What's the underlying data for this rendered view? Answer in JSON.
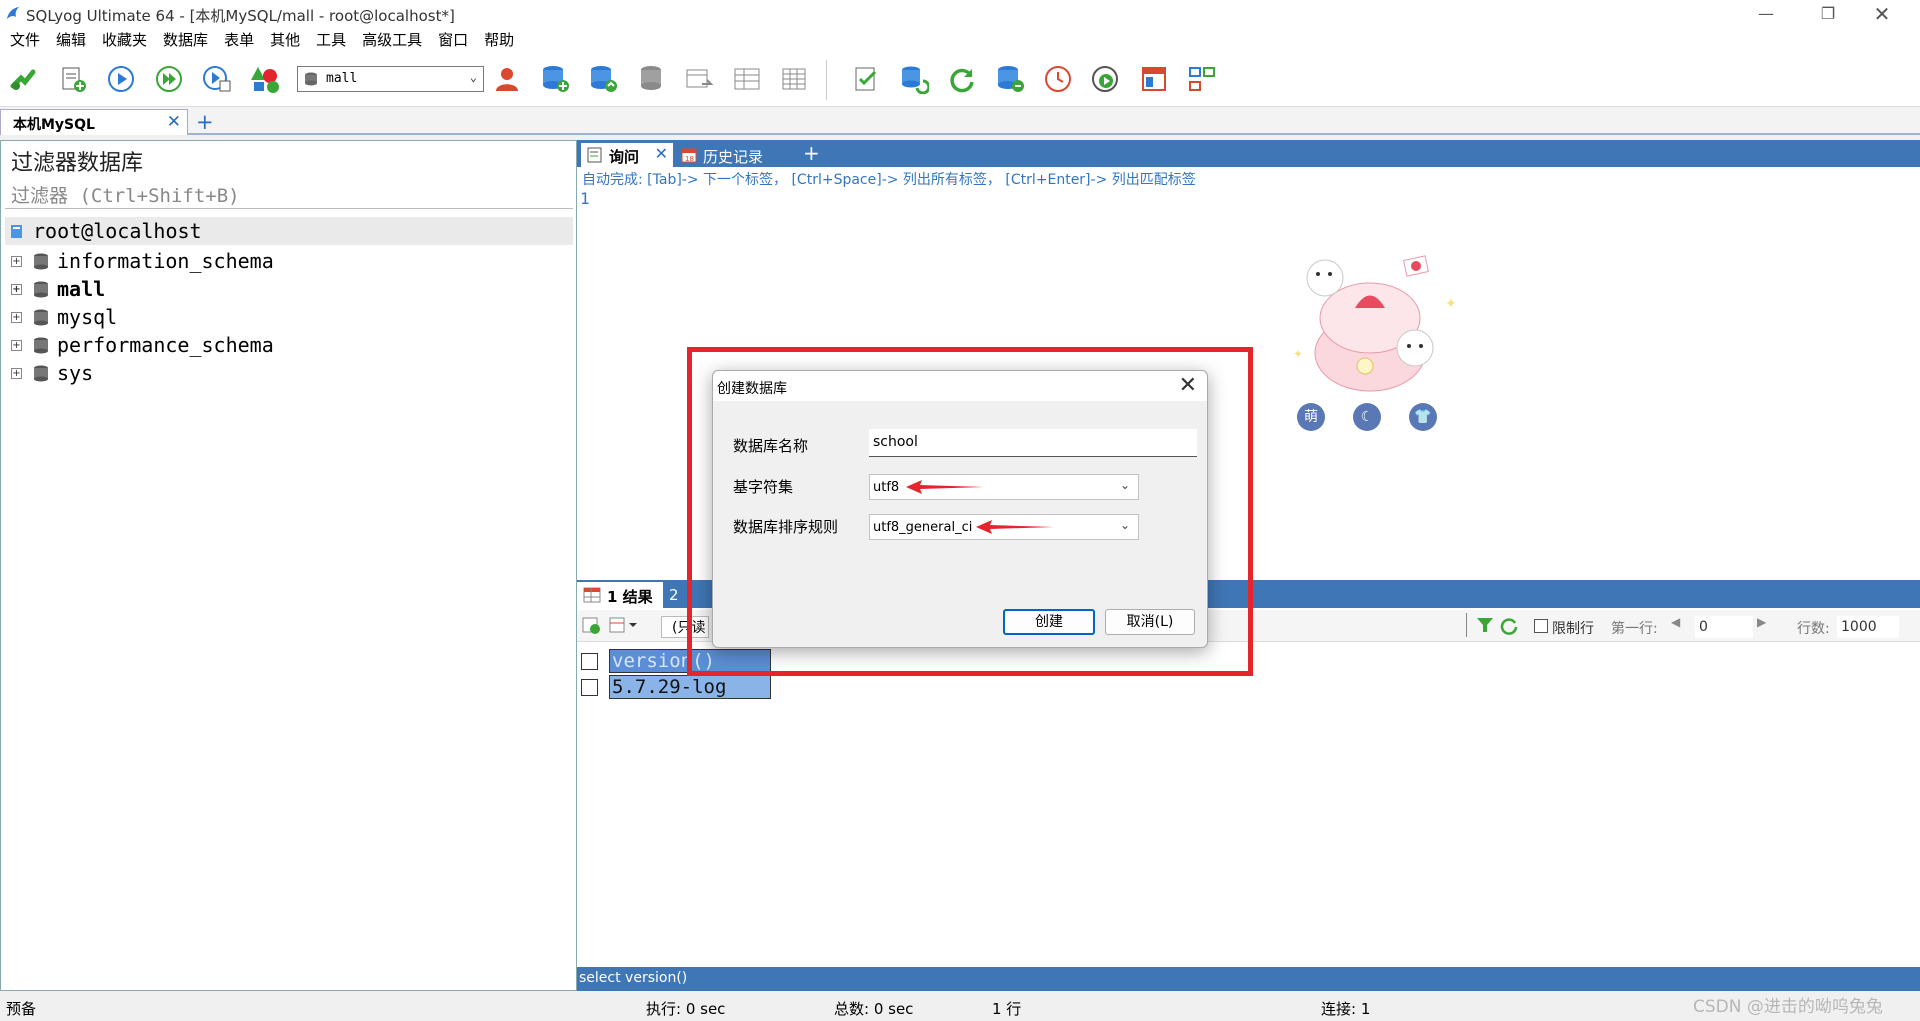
{
  "window": {
    "title": "SQLyog Ultimate 64 - [本机MySQL/mall - root@localhost*]",
    "min_icon": "minimize-icon",
    "max_icon": "restore-icon",
    "close_icon": "close-icon"
  },
  "menu": [
    "文件",
    "编辑",
    "收藏夹",
    "数据库",
    "表单",
    "其他",
    "工具",
    "高级工具",
    "窗口",
    "帮助"
  ],
  "toolbar": {
    "db_selector_value": "mall"
  },
  "connection_tabs": {
    "active": "本机MySQL",
    "add": "+"
  },
  "left": {
    "filter_title": "过滤器数据库",
    "filter_placeholder": "过滤器 (Ctrl+Shift+B)",
    "root": "root@localhost",
    "databases": [
      "information_schema",
      "mall",
      "mysql",
      "performance_schema",
      "sys"
    ],
    "bold_db": "mall"
  },
  "query_tabs": {
    "tab1": "询问",
    "tab2": "历史记录",
    "add": "+"
  },
  "editor": {
    "autocomplete_hint": "自动完成: [Tab]-> 下一个标签， [Ctrl+Space]-> 列出所有标签， [Ctrl+Enter]-> 列出匹配标签",
    "line_number": "1"
  },
  "results": {
    "tab1": "1 结果",
    "tab2": "2",
    "readonly_partial": "(只读",
    "limit_label": "限制行",
    "first_row_label": "第一行:",
    "first_row_value": "0",
    "rows_label": "行数:",
    "rows_value": "1000",
    "header": "version()",
    "row_value": "5.7.29-log"
  },
  "sql_bar": "select version()",
  "status": {
    "left": "预备",
    "exec": "执行: 0 sec",
    "total": "总数: 0 sec",
    "rows": "1 行",
    "conn": "连接: 1"
  },
  "dialog": {
    "title": "创建数据库",
    "name_label": "数据库名称",
    "name_value": "school",
    "charset_label": "基字符集",
    "charset_value": "utf8",
    "collation_label": "数据库排序规则",
    "collation_value": "utf8_general_ci",
    "create_button": "创建",
    "cancel_button": "取消(L)"
  },
  "decor_buttons": [
    "萌",
    "☾",
    "👕"
  ],
  "watermark": "CSDN @进击的呦呜兔兔",
  "colors": {
    "accent_blue": "#3f76b5",
    "highlight_red": "#e4262c",
    "selection_blue": "#5b8ed6"
  }
}
